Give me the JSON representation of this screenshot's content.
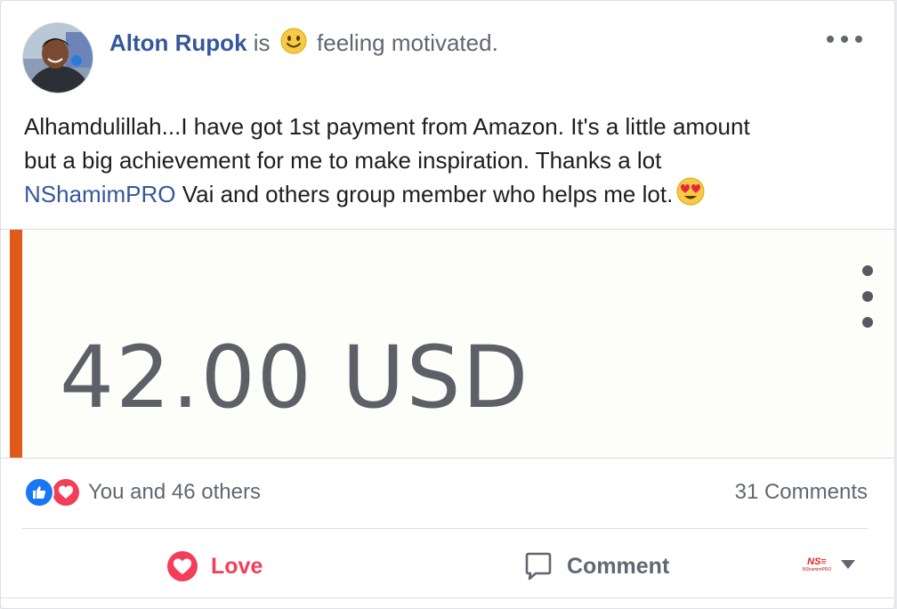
{
  "post": {
    "author": "Alton Rupok",
    "verb": "is",
    "feeling": "feeling motivated.",
    "feeling_icon": "smiley-face-icon",
    "text_line1": "Alhamdulillah...I have got 1st payment from Amazon. It's a little amount",
    "text_line2": "but a big achievement for me to make inspiration. Thanks a lot",
    "mention": "NShamimPRO",
    "text_line3": " Vai and others group member who helps me lot.",
    "end_emoji": "heart-eyes-emoji",
    "image": {
      "amount": "42.00 USD",
      "accent_color": "#e05a1c"
    }
  },
  "reactions": {
    "icons": [
      "like-icon",
      "love-icon"
    ],
    "summary": "You and 46 others",
    "comments": "31 Comments"
  },
  "actions": {
    "love": "Love",
    "comment": "Comment",
    "share_as_logo": "NShamimPRO"
  },
  "colors": {
    "link": "#365899",
    "love": "#f33e58",
    "like": "#1877f2"
  }
}
